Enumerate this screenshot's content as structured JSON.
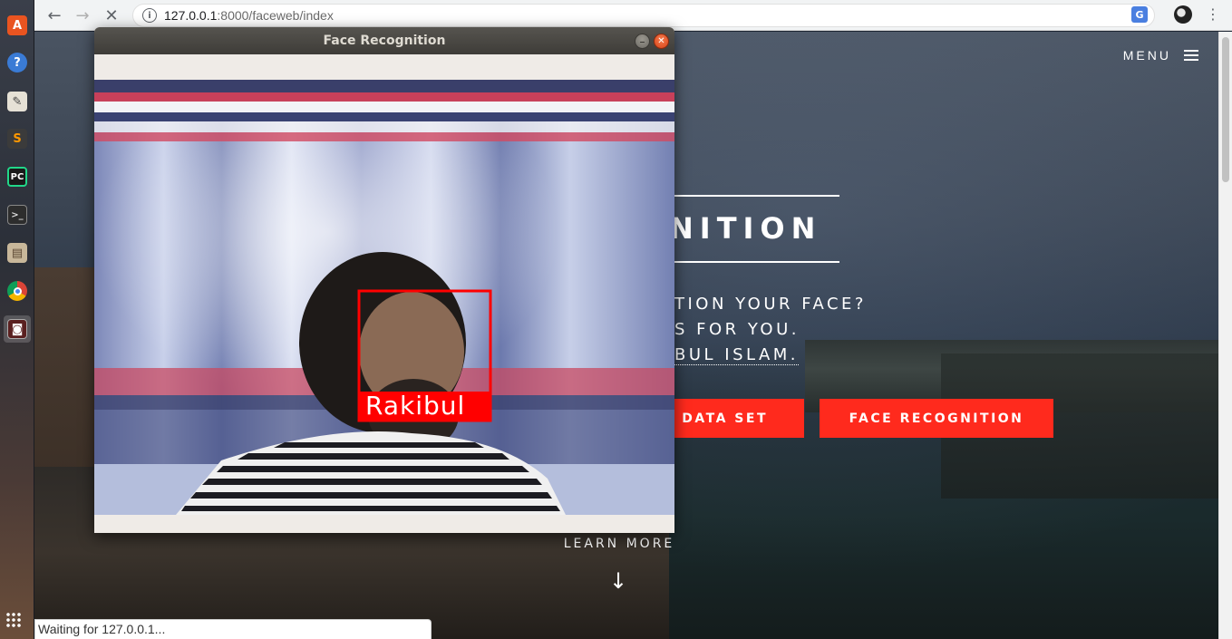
{
  "browser": {
    "url_host": "127.0.0.1",
    "url_rest": ":8000/faceweb/index",
    "status": "Waiting for 127.0.0.1..."
  },
  "launcher": {
    "items": [
      {
        "name": "ubuntu-software-icon",
        "glyph": "A",
        "color": "#e95420"
      },
      {
        "name": "help-icon",
        "glyph": "?",
        "color": "#3a7bd5"
      },
      {
        "name": "text-editor-icon",
        "glyph": "✎",
        "color": "#d8d2c4"
      },
      {
        "name": "sublime-text-icon",
        "glyph": "S",
        "color": "#ff9800"
      },
      {
        "name": "pycharm-icon",
        "glyph": "PC",
        "color": "#21d789"
      },
      {
        "name": "terminal-icon",
        "glyph": ">_",
        "color": "#2d2d2d"
      },
      {
        "name": "files-icon",
        "glyph": "▤",
        "color": "#b98a5c"
      },
      {
        "name": "chrome-icon",
        "glyph": "●",
        "color": "#db4437"
      },
      {
        "name": "opencv-window-icon",
        "glyph": "◙",
        "color": "#8a2b2b"
      }
    ]
  },
  "page": {
    "menu_label": "MENU",
    "hero_title": "NITION",
    "subtitle_lines": [
      "TION YOUR FACE?",
      "S FOR YOU.",
      "BUL ISLAM."
    ],
    "btn_dataset": "G DATA SET",
    "btn_recognition": "FACE RECOGNITION",
    "learn_more": "LEARN MORE",
    "arrow": "↓"
  },
  "cv_window": {
    "title": "Face Recognition",
    "face_label": "Rakibul"
  },
  "colors": {
    "accent_red": "#ff2a1d",
    "detect_red": "#ff0000"
  }
}
